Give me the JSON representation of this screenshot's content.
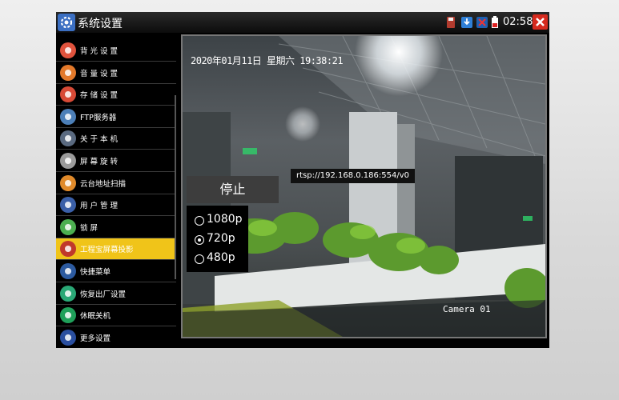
{
  "window": {
    "title": "系统设置",
    "time": "02:58"
  },
  "status_icons": [
    "sd-card-icon",
    "download-icon",
    "network-icon",
    "battery-icon"
  ],
  "sidebar": {
    "items": [
      {
        "label": "背 光 设 置",
        "icon": "backlight-icon",
        "color": "#e0533d"
      },
      {
        "label": "音 量 设 置",
        "icon": "volume-icon",
        "color": "#e3792a"
      },
      {
        "label": "存 储 设 置",
        "icon": "storage-icon",
        "color": "#d74a36"
      },
      {
        "label": "FTP服务器",
        "icon": "ftp-icon",
        "color": "#4c7fb8"
      },
      {
        "label": "关 于 本 机",
        "icon": "about-icon",
        "color": "#5a6a80"
      },
      {
        "label": "屏 幕 旋 转",
        "icon": "rotate-icon",
        "color": "#9a9a9a"
      },
      {
        "label": "云台地址扫描",
        "icon": "ptz-scan-icon",
        "color": "#e08a2a"
      },
      {
        "label": "用 户 管 理",
        "icon": "user-icon",
        "color": "#3a5fa8"
      },
      {
        "label": "锁     屏",
        "icon": "lock-icon",
        "color": "#4caf50"
      },
      {
        "label": "工程宝屏幕投影",
        "icon": "projection-icon",
        "color": "#c0392b",
        "active": true
      },
      {
        "label": "快捷菜单",
        "icon": "shortcut-icon",
        "color": "#2c5aa0"
      },
      {
        "label": "恢复出厂设置",
        "icon": "restore-icon",
        "color": "#2aa876"
      },
      {
        "label": "休眠关机",
        "icon": "sleep-icon",
        "color": "#1fa05a"
      },
      {
        "label": "更多设置",
        "icon": "more-icon",
        "color": "#2a4fa0"
      }
    ]
  },
  "video": {
    "timestamp": "2020年01月11日 星期六 19:38:21",
    "camera": "Camera 01"
  },
  "stream": {
    "url": "rtsp://192.168.0.186:554/v0"
  },
  "controls": {
    "stop_label": "停止",
    "resolutions": [
      {
        "label": "1080p",
        "selected": false
      },
      {
        "label": "720p",
        "selected": true
      },
      {
        "label": "480p",
        "selected": false
      }
    ]
  },
  "colors": {
    "accent": "#f0c419",
    "close": "#d62a1e"
  }
}
